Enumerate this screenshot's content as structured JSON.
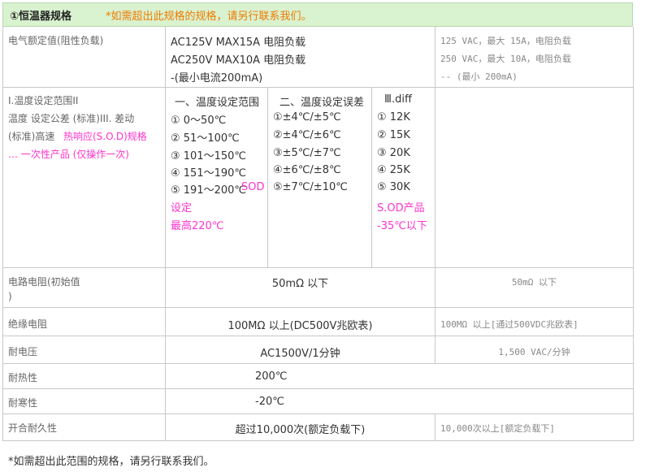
{
  "header": {
    "title": "①恒温器规格",
    "note": "*如需超出此规格的规格，请另行联系我们。"
  },
  "rows": {
    "rating": {
      "label": "电气额定值(阻性负载)",
      "values": [
        "AC125V MAX15A 电阻负载",
        "AC250V MAX10A 电阻负载",
        "-(最小电流200mA)"
      ],
      "en": [
        "125 VAC，最大 15A，电阻负载",
        "250 VAC，最大 10A，电阻负载",
        "-- (最小 200mA)"
      ]
    },
    "temp": {
      "label_lines": [
        "I.温度设定范围II",
        "温度 设定公差 (标准)III. 差动",
        "(标准)高速"
      ],
      "label_sod": "热响应(S.O.D)规格",
      "label_one": "… 一次性产品 (仅操作一次)",
      "col1_title": "一、温度设定范围",
      "col1": [
        "① 0～50℃",
        "② 51～100℃",
        "③ 101～150℃",
        "④ 151～190℃",
        "⑤ 191～200℃"
      ],
      "col1_sod": "SOD",
      "col1_sod2": "设定",
      "col1_sod3": "最高220℃",
      "col2_title": "二、温度设定误差",
      "col2": [
        "①±4℃/±5℃",
        "②±4℃/±6℃",
        "③±5℃/±7℃",
        "④±6℃/±8℃",
        "⑤±7℃/±10℃"
      ],
      "col3_title": "Ⅲ.diff",
      "col3": [
        "① 12K",
        "② 15K",
        "③ 20K",
        "④ 25K",
        "⑤ 30K"
      ],
      "col3_sod": "S.OD产品",
      "col3_sod2": "-35℃以下"
    },
    "circuit": {
      "label1": "电路电阻(初始值",
      "label2": ")",
      "value": "50mΩ 以下",
      "en": "50mΩ 以下"
    },
    "insulation": {
      "label": "绝缘电阻",
      "value": "100MΩ 以上(DC500V兆欧表)",
      "en": "100MΩ 以上[通过500VDC兆欧表]"
    },
    "voltage": {
      "label": "耐电压",
      "value": "AC1500V/1分钟",
      "en": "1,500 VAC/分钟"
    },
    "heat": {
      "label": "耐热性",
      "value": "200℃"
    },
    "cold": {
      "label": "耐寒性",
      "value": "-20℃"
    },
    "durability": {
      "label": "开合耐久性",
      "value": "超过10,000次(额定负载下)",
      "en": "10,000次以上[额定负载下]"
    }
  },
  "footer": {
    "note": "*如需超出此范围的规格，请另行联系我们。"
  },
  "colors": {
    "header_bg": "#d9f2cf",
    "note": "#f07a00",
    "highlight": "#ff33cc",
    "border": "#c8c8c8"
  }
}
